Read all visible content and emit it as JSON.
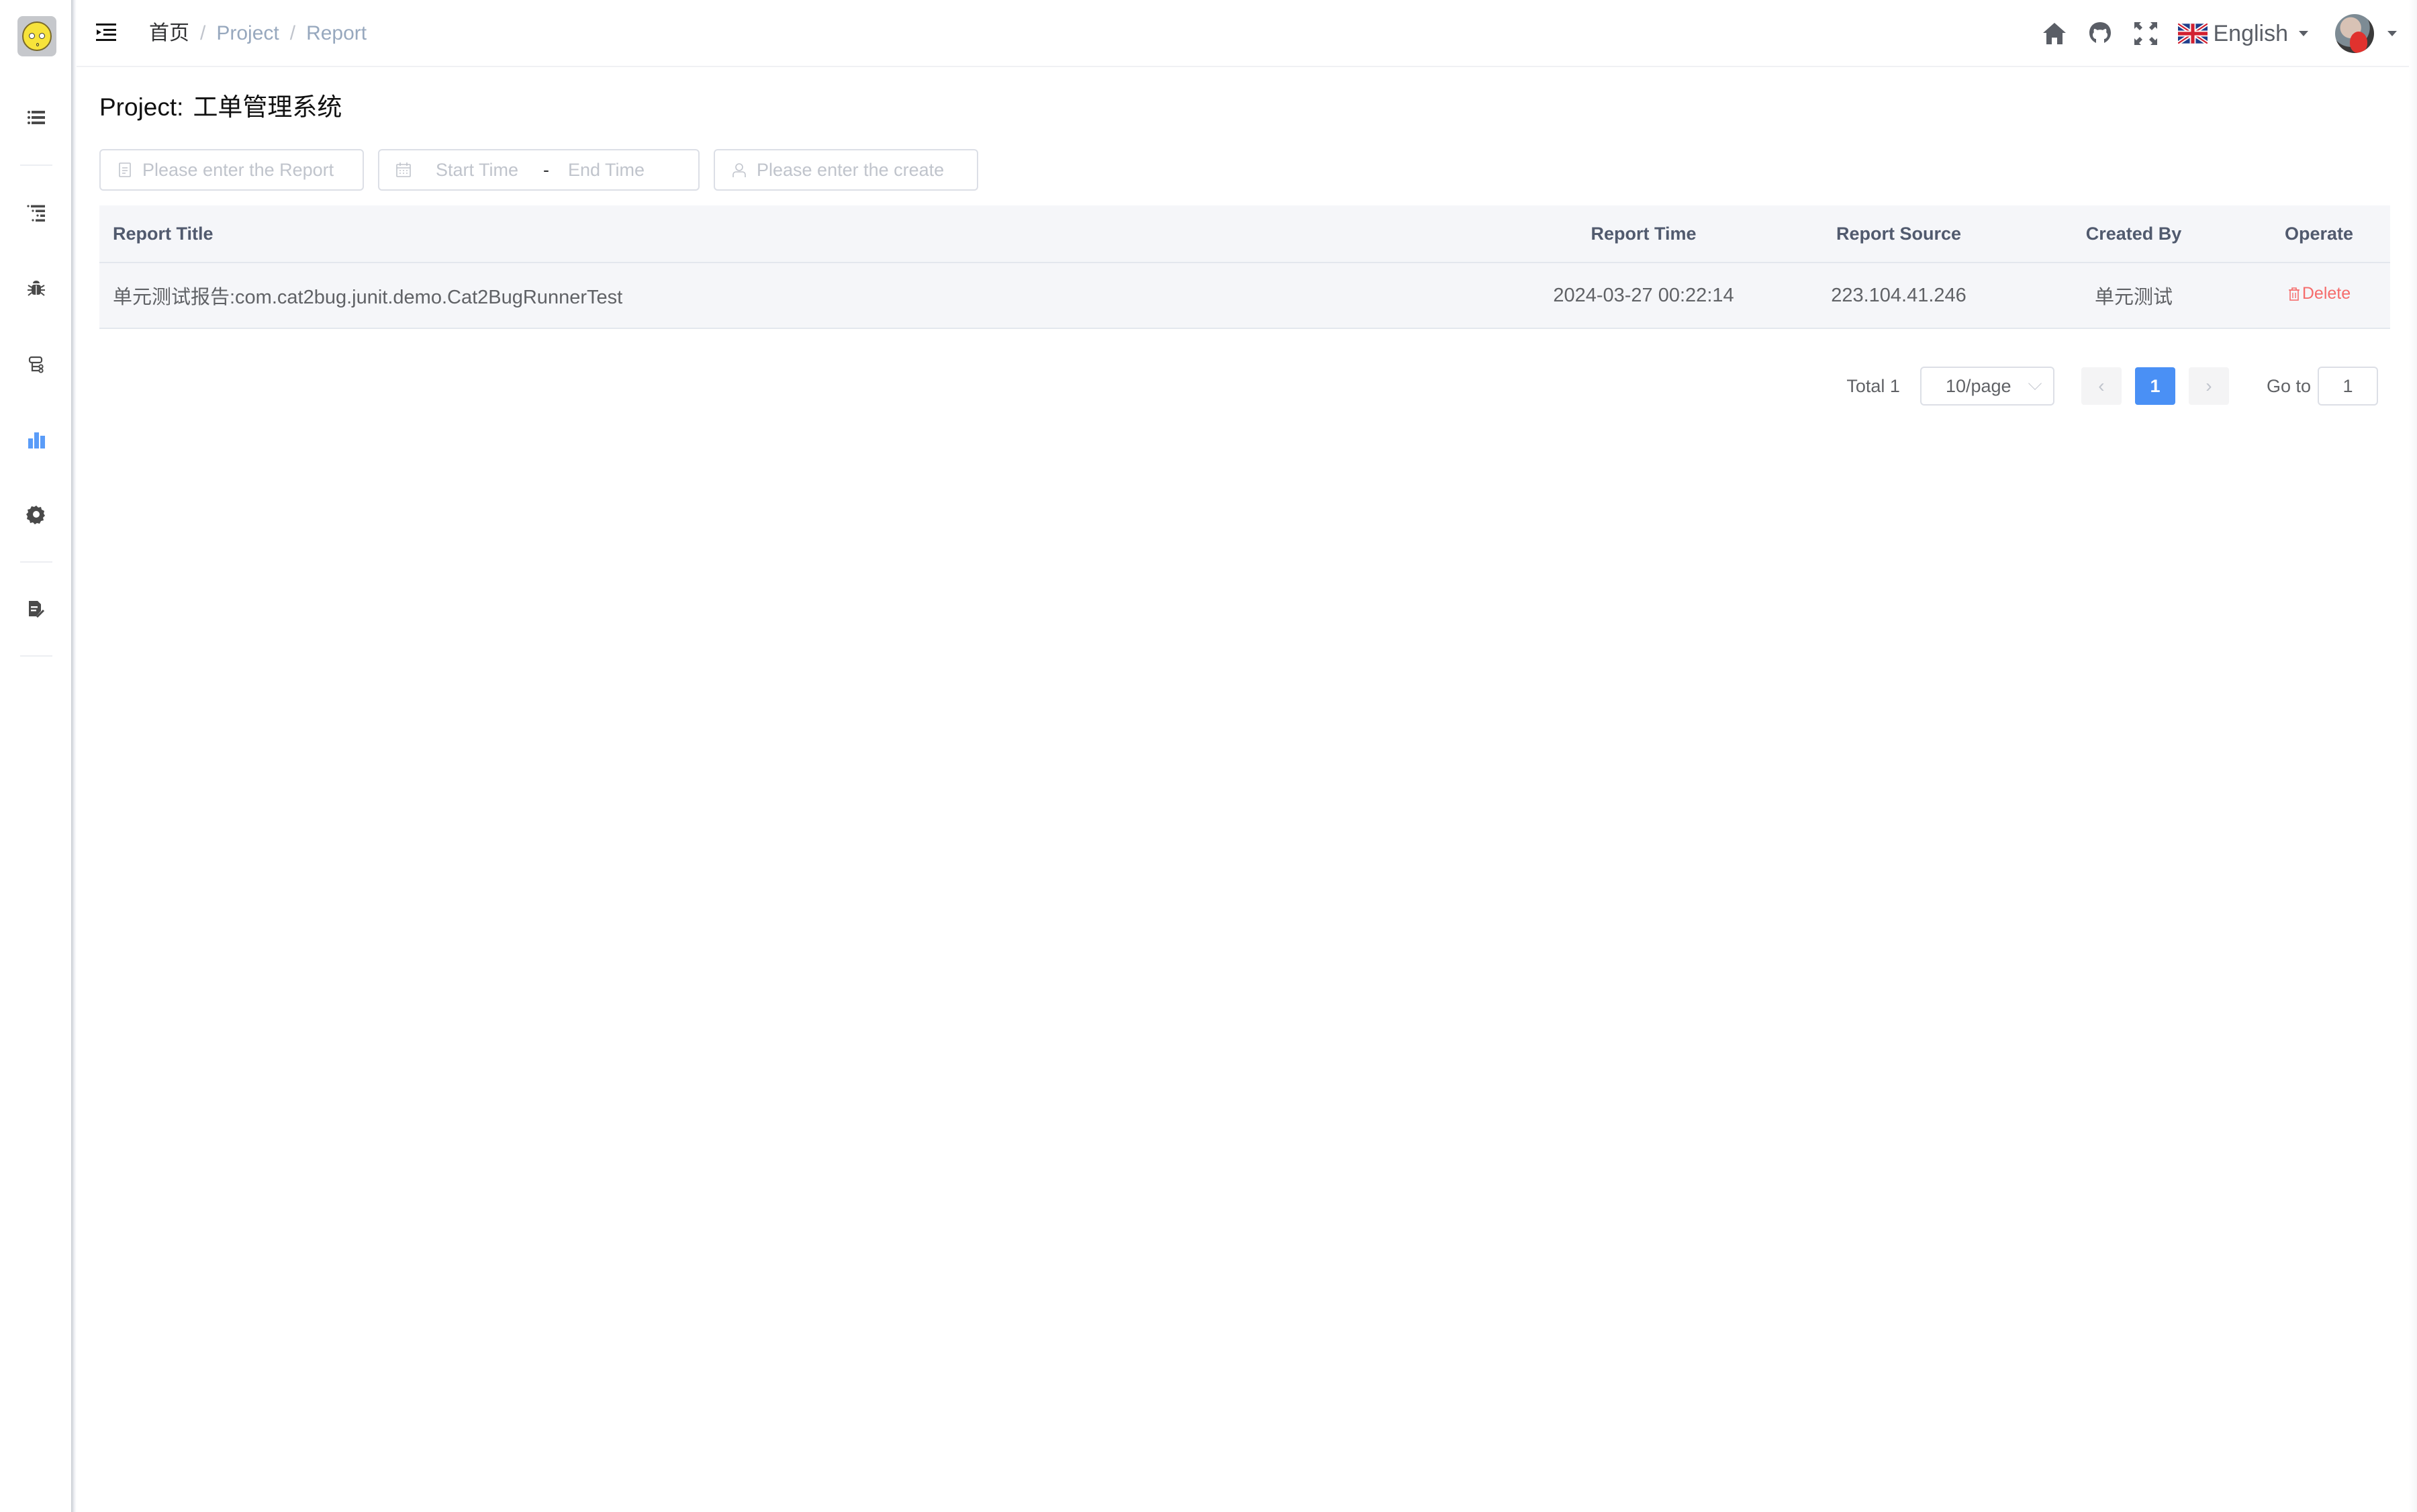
{
  "sidebar": {
    "items": [
      {
        "icon": "list-icon",
        "label": "Project List",
        "active": false
      },
      {
        "icon": "tree-list-icon",
        "label": "Cases",
        "active": false
      },
      {
        "icon": "bug-icon",
        "label": "Defects",
        "active": false
      },
      {
        "icon": "module-tree-icon",
        "label": "Modules",
        "active": false
      },
      {
        "icon": "bar-chart-icon",
        "label": "Reports",
        "active": true
      },
      {
        "icon": "gear-icon",
        "label": "Settings",
        "active": false
      },
      {
        "icon": "document-edit-icon",
        "label": "Documents",
        "active": false
      }
    ],
    "active_color": "#4a90f5"
  },
  "header": {
    "breadcrumb": {
      "home": "首页",
      "items": [
        "Project",
        "Report"
      ],
      "separator": "/"
    },
    "language": "English",
    "icons": [
      "home-icon",
      "github-icon",
      "fullscreen-icon"
    ]
  },
  "page": {
    "title_label": "Project:",
    "project_name": "工单管理系统"
  },
  "filters": {
    "report_title_placeholder": "Please enter the Report",
    "start_time_placeholder": "Start Time",
    "range_separator": "-",
    "end_time_placeholder": "End Time",
    "creator_placeholder": "Please enter the create"
  },
  "table": {
    "columns": [
      "Report Title",
      "Report Time",
      "Report Source",
      "Created By",
      "Operate"
    ],
    "rows": [
      {
        "title": "单元测试报告:com.cat2bug.junit.demo.Cat2BugRunnerTest",
        "time": "2024-03-27 00:22:14",
        "source": "223.104.41.246",
        "created_by": "单元测试",
        "operate": "Delete"
      }
    ]
  },
  "pagination": {
    "total_label": "Total 1",
    "page_size": "10/page",
    "prev": "‹",
    "current_page": "1",
    "next": "›",
    "goto_label": "Go to",
    "goto_value": "1"
  },
  "colors": {
    "primary": "#4a90f5",
    "danger": "#f56c6c",
    "breadcrumb_link": "#97a8be"
  }
}
